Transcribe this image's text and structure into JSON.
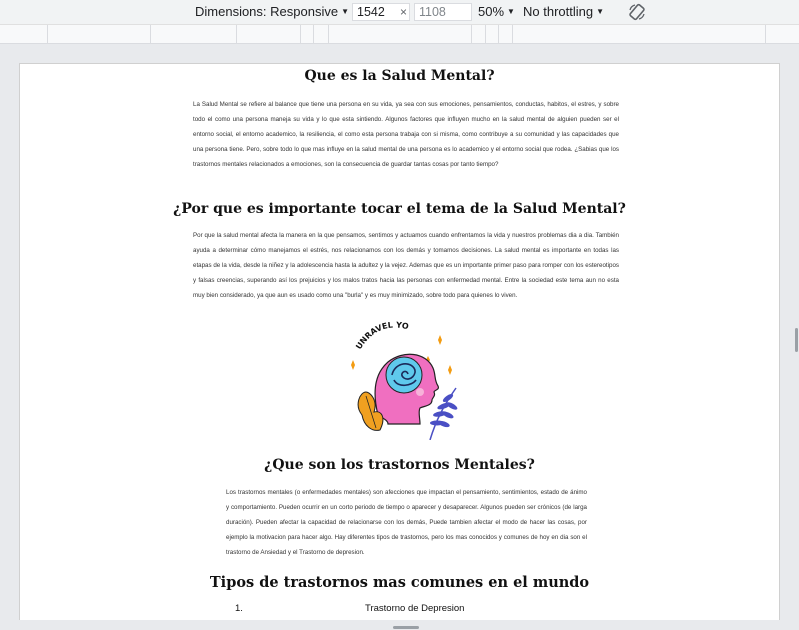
{
  "toolbar": {
    "dimensions_label": "Dimensions: Responsive",
    "width_value": "1542",
    "height_value": "1108",
    "times": "×",
    "zoom_label": "50%",
    "throttle_label": "No throttling"
  },
  "sections": [
    {
      "title": "Que es la Salud Mental?",
      "text": "La Salud Mental se refiere al balance que tiene una persona en su vida, ya sea con sus emociones, pensamientos, conductas, habitos, el estres, y sobre todo el como una persona maneja su vida y lo que esta sintiendo. Algunos factores que influyen mucho en la salud mental de alguien pueden ser el entorno social, el entorno academico, la resiliencia, el como esta persona trabaja con si misma, como contribuye a su comunidad y las capacidades que una persona tiene. Pero, sobre todo lo que mas influye en la salud mental de una persona es lo academico y el entorno social que rodea. ¿Sabias que los trastornos mentales relacionados a emociones, son la consecuencia de guardar tantas cosas por tanto tiempo?"
    },
    {
      "title": "¿Por que es importante tocar el tema de la Salud Mental?",
      "text": "Por que la salud mental afecta la manera en la que pensamos, sentimos y actuamos cuando enfrentamos la vida y nuestros problemas dia a dia. También ayuda a determinar cómo manejamos el estrés, nos relacionamos con los demás y tomamos decisiones. La salud mental es importante en todas las etapas de la vida, desde la niñez y la adolescencia hasta la adultez y la vejez. Ademas que es un importante primer paso para romper con los estereotipos y falsas creencias, superando así los prejuicios y los malos tratos hacia las personas con enfermedad mental. Entre la sociedad este tema aun no esta muy bien considerado, ya que aun es usado como una \"burla\" y es muy minimizado, sobre todo para quienes lo viven."
    },
    {
      "title": "¿Que son los trastornos Mentales?",
      "text": "Los trastornos mentales (o enfermedades mentales) son afecciones que impactan el pensamiento, sentimientos, estado de ánimo y comportamiento. Pueden ocurrir en un corto periodo de tiempo o aparecer y desaparecer. Algunos pueden ser crónicos (de larga duración). Pueden afectar la capacidad de relacionarse con los demás, Puede tambien afectar el modo de hacer las cosas, por ejemplo la motivacion para hacer algo. Hay diferentes tipos de trastornos, pero los mas conocidos y comunes de hoy en dia son el trastorno de Ansiedad y el Trastorno de depresion."
    },
    {
      "title": "Tipos de trastornos mas comunes en el mundo"
    }
  ],
  "illustration": {
    "caption": "UNRAVEL YOUR MIND!"
  },
  "list": [
    {
      "num": "1.",
      "label": "Trastorno de Depresion"
    }
  ],
  "colors": {
    "head_pink": "#f06fc0",
    "leaf_blue": "#4a4fc4",
    "leaf_orange": "#f0a020",
    "accent_sparkle": "#f39c12"
  }
}
